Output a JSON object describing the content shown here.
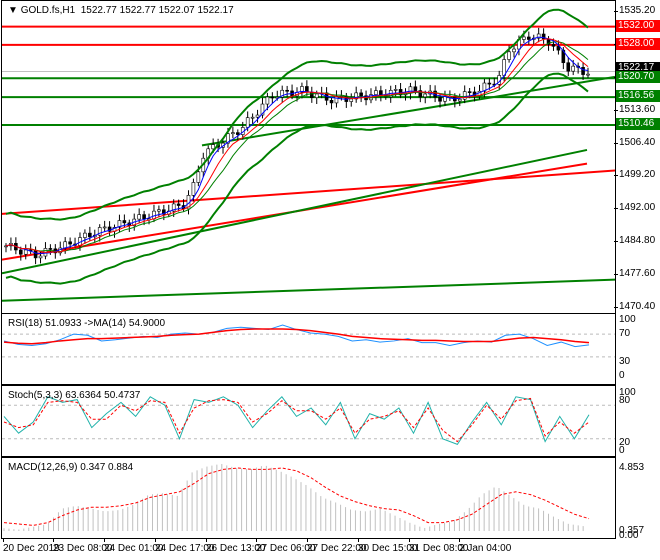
{
  "header": {
    "symbol": "GOLD.fs,H1",
    "ohlc": "1522.77 1522.77 1522.07 1522.17"
  },
  "price_axis": [
    "1535.20",
    "1528.00",
    "1520.70",
    "1513.60",
    "1506.40",
    "1499.20",
    "1492.00",
    "1484.80",
    "1477.60",
    "1470.40"
  ],
  "price_axis_values": [
    1535.2,
    1528,
    1520.8,
    1513.6,
    1506.4,
    1499.2,
    1492,
    1484.8,
    1477.6,
    1470.4
  ],
  "levels": [
    {
      "label": "1532.00",
      "value": 1532.0,
      "color": "#ff0000"
    },
    {
      "label": "1528.00",
      "value": 1528.0,
      "color": "#ff0000"
    },
    {
      "label": "1520.70",
      "value": 1520.7,
      "color": "#008000"
    },
    {
      "label": "1516.56",
      "value": 1516.56,
      "color": "#008000"
    },
    {
      "label": "1510.46",
      "value": 1510.46,
      "color": "#008000"
    }
  ],
  "current_price": {
    "label": "1522.17",
    "value": 1522.17
  },
  "price_path": [
    [
      0,
      1484
    ],
    [
      6,
      1482
    ],
    [
      12,
      1484
    ],
    [
      18,
      1487
    ],
    [
      24,
      1489
    ],
    [
      30,
      1491
    ],
    [
      36,
      1493
    ],
    [
      38,
      1497
    ],
    [
      40,
      1504
    ],
    [
      44,
      1507
    ],
    [
      48,
      1510
    ],
    [
      54,
      1517
    ],
    [
      60,
      1518
    ],
    [
      66,
      1516
    ],
    [
      74,
      1517
    ],
    [
      82,
      1518
    ],
    [
      90,
      1516
    ],
    [
      96,
      1518
    ],
    [
      100,
      1521
    ],
    [
      102,
      1527
    ],
    [
      106,
      1530
    ],
    [
      110,
      1529
    ],
    [
      114,
      1523
    ],
    [
      118,
      1522
    ]
  ],
  "rsi": {
    "label": "RSI(18) 51.0933  ->MA(14) 54.9000",
    "axis": [
      "100",
      "70",
      "30",
      "0"
    ],
    "values": [
      58,
      52,
      50,
      53,
      60,
      70,
      68,
      58,
      60,
      63,
      66,
      64,
      70,
      72,
      70,
      73,
      80,
      82,
      80,
      78,
      86,
      78,
      72,
      70,
      66,
      58,
      60,
      56,
      58,
      62,
      55,
      55,
      50,
      55,
      58,
      56,
      68,
      70,
      62,
      50,
      56,
      48,
      51
    ],
    "ma": [
      56,
      54,
      53,
      55,
      58,
      60,
      62,
      62,
      63,
      64,
      65,
      66,
      68,
      69,
      70,
      73,
      76,
      78,
      79,
      79,
      79,
      78,
      76,
      73,
      70,
      66,
      64,
      62,
      61,
      60,
      59,
      59,
      58,
      57,
      57,
      57,
      60,
      63,
      64,
      62,
      60,
      57,
      55
    ]
  },
  "stoch": {
    "label": "Stoch(5,3,3) 63.6364 50.4737",
    "axis": [
      "100",
      "80",
      "20",
      "0"
    ],
    "main": [
      60,
      30,
      50,
      95,
      85,
      90,
      40,
      65,
      85,
      60,
      95,
      80,
      20,
      90,
      85,
      95,
      80,
      40,
      70,
      95,
      60,
      75,
      45,
      85,
      20,
      65,
      55,
      75,
      30,
      85,
      20,
      10,
      50,
      85,
      45,
      95,
      90,
      15,
      60,
      20,
      63
    ],
    "signal": [
      50,
      40,
      45,
      85,
      88,
      85,
      55,
      55,
      80,
      70,
      88,
      85,
      30,
      75,
      88,
      90,
      85,
      50,
      65,
      88,
      70,
      70,
      55,
      75,
      30,
      55,
      60,
      70,
      40,
      75,
      35,
      15,
      45,
      80,
      55,
      88,
      92,
      25,
      50,
      30,
      50
    ]
  },
  "macd": {
    "label": "MACD(12,26,9) 0.347 0.884",
    "axis_top": "4.853",
    "axis_mid": "0.357",
    "axis_bot": "0.00",
    "hist": [
      0.2,
      0.1,
      0.3,
      0.5,
      1.6,
      1.8,
      1.6,
      1.4,
      1.5,
      1.9,
      2.6,
      2.7,
      2.5,
      4.2,
      4.6,
      4.8,
      4.5,
      4.4,
      4.7,
      4.3,
      3.8,
      3.2,
      2.4,
      2.0,
      1.5,
      1.4,
      1.6,
      1.1,
      0.6,
      0.2,
      0.5,
      0.7,
      1.5,
      2.6,
      3.2,
      2.5,
      1.8,
      1.6,
      1.0,
      0.5,
      0.35
    ],
    "signal": [
      0.6,
      0.5,
      0.4,
      0.6,
      1.1,
      1.5,
      1.7,
      1.7,
      1.8,
      2.0,
      2.4,
      2.6,
      2.8,
      3.4,
      4.1,
      4.4,
      4.5,
      4.4,
      4.4,
      4.5,
      4.3,
      3.8,
      3.1,
      2.5,
      2.1,
      1.8,
      1.6,
      1.5,
      1.1,
      0.6,
      0.6,
      0.8,
      1.2,
      1.9,
      2.6,
      2.8,
      2.6,
      2.2,
      1.7,
      1.2,
      0.88
    ]
  },
  "time_axis": [
    "20 Dec 2019",
    "23 Dec 08:00",
    "24 Dec 01:00",
    "24 Dec 17:00",
    "26 Dec 13:00",
    "27 Dec 06:00",
    "27 Dec 22:00",
    "30 Dec 15:00",
    "31 Dec 08:00",
    "2 Jan 04:00"
  ],
  "colors": {
    "bull": "#008000",
    "bear": "#ff0000",
    "rsi": "#1e90ff",
    "stoch": "#20b2aa"
  }
}
